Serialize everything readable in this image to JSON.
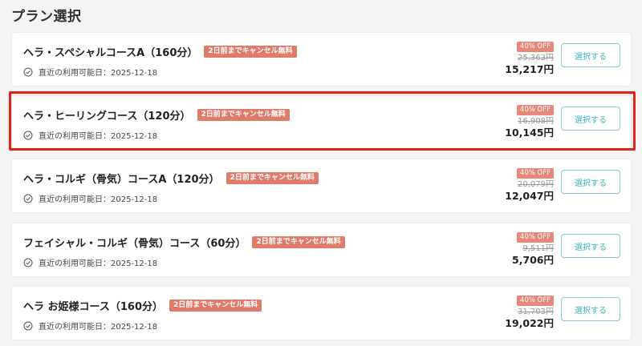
{
  "page": {
    "title": "プラン選択"
  },
  "colors": {
    "accent": "#3bb2bf",
    "badge": "#e07a6b",
    "highlight": "#e0241a"
  },
  "plans": [
    {
      "name": "ヘラ・スペシャルコースA（160分）",
      "badge": "2日前までキャンセル無料",
      "date_label": "直近の利用可能日：2025-12-18",
      "discount": "40% OFF",
      "original_price": "25,363円",
      "price": "15,217円",
      "select_label": "選択する"
    },
    {
      "name": "ヘラ・ヒーリングコース（120分）",
      "badge": "2日前までキャンセル無料",
      "date_label": "直近の利用可能日：2025-12-18",
      "discount": "40% OFF",
      "original_price": "16,908円",
      "price": "10,145円",
      "select_label": "選択する"
    },
    {
      "name": "ヘラ・コルギ（骨気）コースA（120分）",
      "badge": "2日前までキャンセル無料",
      "date_label": "直近の利用可能日：2025-12-18",
      "discount": "40% OFF",
      "original_price": "20,079円",
      "price": "12,047円",
      "select_label": "選択する"
    },
    {
      "name": "フェイシャル・コルギ（骨気）コース（60分）",
      "badge": "2日前までキャンセル無料",
      "date_label": "直近の利用可能日：2025-12-18",
      "discount": "40% OFF",
      "original_price": "9,511円",
      "price": "5,706円",
      "select_label": "選択する"
    },
    {
      "name": "ヘラ お姫様コース（160分）",
      "badge": "2日前までキャンセル無料",
      "date_label": "直近の利用可能日：2025-12-18",
      "discount": "40% OFF",
      "original_price": "31,703円",
      "price": "19,022円",
      "select_label": "選択する"
    }
  ]
}
